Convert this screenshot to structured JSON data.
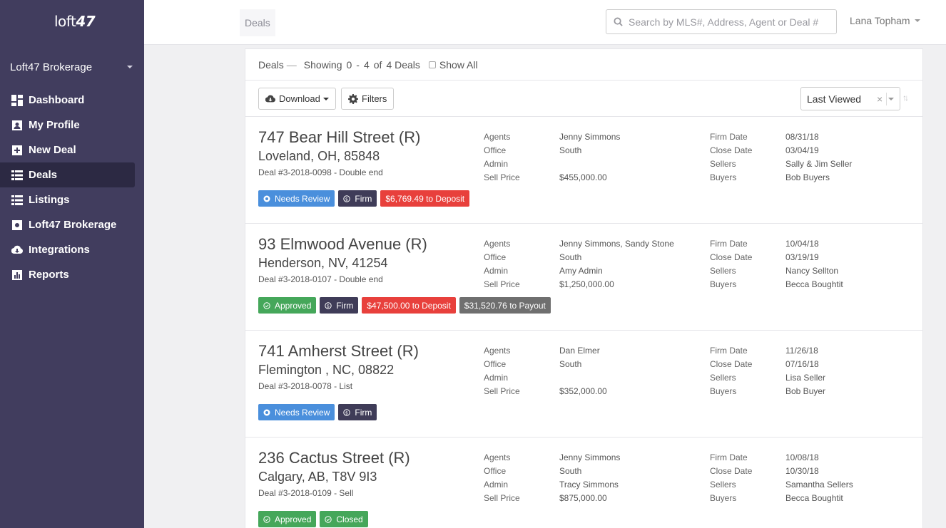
{
  "sidebar": {
    "logo_text": "loft",
    "logo_num": "47",
    "brokerage": "Loft47 Brokerage",
    "items": [
      {
        "label": "Dashboard",
        "icon": "dashboard-icon"
      },
      {
        "label": "My Profile",
        "icon": "profile-icon"
      },
      {
        "label": "New Deal",
        "icon": "plus-square-icon"
      },
      {
        "label": "Deals",
        "icon": "list-icon",
        "active": true
      },
      {
        "label": "Listings",
        "icon": "list-icon"
      },
      {
        "label": "Loft47 Brokerage",
        "icon": "gear-icon"
      },
      {
        "label": "Integrations",
        "icon": "cloud-download-icon"
      },
      {
        "label": "Reports",
        "icon": "bar-chart-icon"
      }
    ]
  },
  "topbar": {
    "breadcrumb": "Deals",
    "search_placeholder": "Search by MLS#, Address, Agent or Deal #",
    "user": "Lana Topham"
  },
  "list": {
    "title": "Deals",
    "sep": "—",
    "showing": "Showing",
    "from": "0",
    "dash": "-",
    "to": "4",
    "of": "of",
    "total": "4 Deals",
    "show_all": "Show All",
    "download": "Download",
    "filters": "Filters",
    "sort_value": "Last Viewed",
    "sort_clear": "×",
    "sort_dir": "↑↓"
  },
  "labels": {
    "agents": "Agents",
    "office": "Office",
    "admin": "Admin",
    "sell_price": "Sell Price",
    "firm_date": "Firm Date",
    "close_date": "Close Date",
    "sellers": "Sellers",
    "buyers": "Buyers"
  },
  "deals": [
    {
      "address": "747 Bear Hill Street (R)",
      "city": "Loveland, OH, 85848",
      "deal_no": "Deal #3-2018-0098 - Double end",
      "agents": "Jenny Simmons",
      "office": "South",
      "admin": "",
      "sell_price": "$455,000.00",
      "firm_date": "08/31/18",
      "close_date": "03/04/19",
      "sellers": "Sally & Jim Seller",
      "buyers": "Bob Buyers",
      "badges": [
        {
          "text": "Needs Review",
          "color": "#4a8fdc",
          "icon": "dot-icon"
        },
        {
          "text": "Firm",
          "color": "#3f3c58",
          "icon": "dollar-circle-icon"
        },
        {
          "text": "$6,769.49 to Deposit",
          "color": "#e8403c",
          "icon": ""
        }
      ]
    },
    {
      "address": "93 Elmwood Avenue (R)",
      "city": "Henderson, NV, 41254",
      "deal_no": "Deal #3-2018-0107 - Double end",
      "agents": "Jenny Simmons, Sandy Stone",
      "office": "South",
      "admin": "Amy Admin",
      "sell_price": "$1,250,000.00",
      "firm_date": "10/04/18",
      "close_date": "03/19/19",
      "sellers": "Nancy Sellton",
      "buyers": "Becca Boughtit",
      "badges": [
        {
          "text": "Approved",
          "color": "#45a75a",
          "icon": "check-circle-icon"
        },
        {
          "text": "Firm",
          "color": "#3f3c58",
          "icon": "dollar-circle-icon"
        },
        {
          "text": "$47,500.00 to Deposit",
          "color": "#e8403c",
          "icon": ""
        },
        {
          "text": "$31,520.76 to Payout",
          "color": "#6f6f6f",
          "icon": ""
        }
      ]
    },
    {
      "address": "741 Amherst Street (R)",
      "city": "Flemington , NC, 08822",
      "deal_no": "Deal #3-2018-0078 - List",
      "agents": "Dan Elmer",
      "office": "South",
      "admin": "",
      "sell_price": "$352,000.00",
      "firm_date": "11/26/18",
      "close_date": "07/16/18",
      "sellers": "Lisa Seller",
      "buyers": "Bob Buyer",
      "badges": [
        {
          "text": "Needs Review",
          "color": "#4a8fdc",
          "icon": "dot-icon"
        },
        {
          "text": "Firm",
          "color": "#3f3c58",
          "icon": "dollar-circle-icon"
        }
      ]
    },
    {
      "address": "236 Cactus Street (R)",
      "city": "Calgary, AB, T8V 9I3",
      "deal_no": "Deal #3-2018-0109 - Sell",
      "agents": "Jenny Simmons",
      "office": "South",
      "admin": "Tracy Simmons",
      "sell_price": "$875,000.00",
      "firm_date": "10/08/18",
      "close_date": "10/30/18",
      "sellers": "Samantha Sellers",
      "buyers": "Becca Boughtit",
      "badges": [
        {
          "text": "Approved",
          "color": "#45a75a",
          "icon": "check-circle-icon"
        },
        {
          "text": "Closed",
          "color": "#45a75a",
          "icon": "check-circle-icon"
        }
      ]
    }
  ]
}
